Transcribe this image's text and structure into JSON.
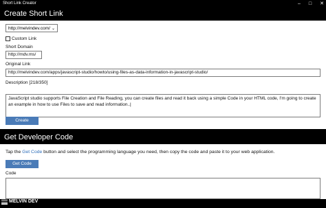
{
  "window": {
    "title": "Short Link Creator",
    "controls": [
      "–",
      "□",
      "✕"
    ]
  },
  "create_panel": {
    "header": "Create Short Link",
    "domain_select": {
      "value": "http://melvindev.com/"
    },
    "custom_link_label": "Custom Link",
    "short_domain_label": "Short Domain",
    "short_domain_value": "http://mdv.ms/",
    "original_link_label": "Original Link",
    "original_link_value": "http://melvindev.com/apps/javascript-studio/howto/using-files-as-data-information-in-javascript-studio/",
    "description_label": "Description [218/350]",
    "description_value": "JavaScript studio supports File Creation and File Reading, you can create files and read it back using a simple Code in your HTML code, I'm going to create an example in how to use Files to save and read information..|",
    "create_button": "Create"
  },
  "developer_panel": {
    "header": "Get Developer Code",
    "info_prefix": "Tap the ",
    "info_link": "Get Code",
    "info_suffix": " button and select the programming language you need, then copy the code and paste it to your web application.",
    "get_code_button": "Get Code",
    "code_label": "Code",
    "code_value": ""
  },
  "branding": {
    "logo_text": "MELVIN DEV"
  },
  "colors": {
    "button": "#4a7bb7",
    "link": "#2b6cb8",
    "header_bg": "#000000"
  }
}
